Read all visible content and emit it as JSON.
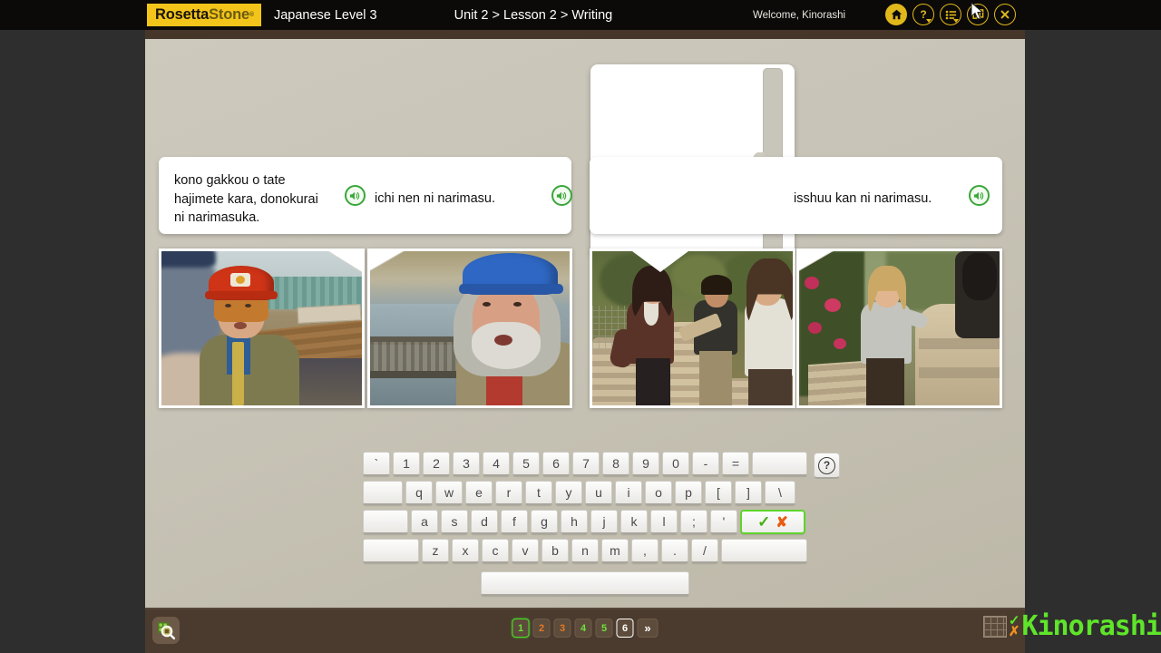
{
  "app": {
    "brand_primary": "RosettaStone",
    "brand_part1": "Rosetta",
    "brand_part2": "Stone",
    "course": "Japanese Level 3",
    "breadcrumb": "Unit 2 > Lesson 2 > Writing",
    "welcome": "Welcome, Kinorashi",
    "accent_yellow": "#f3c51a",
    "accent_green": "#4ddb2a",
    "accent_orange": "#e07a28",
    "bar_dark": "#0c0a08",
    "bar_brown": "#4a3b2e",
    "stage_bg": "#c7c3b6"
  },
  "topbar": {
    "icons": [
      {
        "name": "home-icon",
        "label": "Home",
        "glyph": "home",
        "dropdown": false,
        "filled": true
      },
      {
        "name": "help-icon",
        "label": "Help",
        "glyph": "?",
        "dropdown": true,
        "filled": false
      },
      {
        "name": "menu-icon",
        "label": "Menu",
        "glyph": "list",
        "dropdown": true,
        "filled": false
      },
      {
        "name": "resources-icon",
        "label": "Resources",
        "glyph": "book",
        "dropdown": false,
        "filled": false
      },
      {
        "name": "close-icon",
        "label": "Close",
        "glyph": "x",
        "dropdown": false,
        "filled": false
      }
    ]
  },
  "panels": [
    {
      "id": "panel-question",
      "text": "kono gakkou o tate\nhajimete kara, donokurai\nni narimasuka.",
      "speaker_label": "Play audio",
      "has_speaker": true
    },
    {
      "id": "panel-answer-1",
      "text": "ichi nen ni narimasu.",
      "speaker_label": "Play audio",
      "has_speaker": true
    },
    {
      "id": "panel-answer-2",
      "text": "isshuu kan ni narimasu.",
      "speaker_label": "Play audio",
      "has_speaker": true
    }
  ],
  "writing_input": {
    "value": "",
    "placeholder": "",
    "caret_visible": true
  },
  "photos": [
    {
      "id": "photo-1",
      "alt": "Man in red hard hat at construction site talking"
    },
    {
      "id": "photo-2",
      "alt": "Bearded man in blue hard hat with hood outdoors"
    },
    {
      "id": "photo-3",
      "alt": "Woman in brown top with people stacking stones in garden"
    },
    {
      "id": "photo-4",
      "alt": "Woman in grey sweater beside stone wall in garden"
    }
  ],
  "keyboard": {
    "help_label": "?",
    "rows": [
      {
        "name": "keyboard-row-numbers",
        "keys": [
          {
            "label": "`",
            "cls": ""
          },
          {
            "label": "1",
            "cls": ""
          },
          {
            "label": "2",
            "cls": ""
          },
          {
            "label": "3",
            "cls": ""
          },
          {
            "label": "4",
            "cls": ""
          },
          {
            "label": "5",
            "cls": ""
          },
          {
            "label": "6",
            "cls": ""
          },
          {
            "label": "7",
            "cls": ""
          },
          {
            "label": "8",
            "cls": ""
          },
          {
            "label": "9",
            "cls": ""
          },
          {
            "label": "0",
            "cls": ""
          },
          {
            "label": "-",
            "cls": ""
          },
          {
            "label": "=",
            "cls": ""
          },
          {
            "label": "",
            "cls": "wide-bsp",
            "name": "backspace-key"
          }
        ]
      },
      {
        "name": "keyboard-row-top",
        "keys": [
          {
            "label": "",
            "cls": "wide-tab",
            "name": "tab-key"
          },
          {
            "label": "q",
            "cls": ""
          },
          {
            "label": "w",
            "cls": ""
          },
          {
            "label": "e",
            "cls": ""
          },
          {
            "label": "r",
            "cls": ""
          },
          {
            "label": "t",
            "cls": ""
          },
          {
            "label": "y",
            "cls": ""
          },
          {
            "label": "u",
            "cls": ""
          },
          {
            "label": "i",
            "cls": ""
          },
          {
            "label": "o",
            "cls": ""
          },
          {
            "label": "p",
            "cls": ""
          },
          {
            "label": "[",
            "cls": ""
          },
          {
            "label": "]",
            "cls": ""
          },
          {
            "label": "\\",
            "cls": "wide-bslash"
          }
        ]
      },
      {
        "name": "keyboard-row-home",
        "keys": [
          {
            "label": "",
            "cls": "wide-caps",
            "name": "capslock-key"
          },
          {
            "label": "a",
            "cls": ""
          },
          {
            "label": "s",
            "cls": ""
          },
          {
            "label": "d",
            "cls": ""
          },
          {
            "label": "f",
            "cls": ""
          },
          {
            "label": "g",
            "cls": ""
          },
          {
            "label": "h",
            "cls": ""
          },
          {
            "label": "j",
            "cls": ""
          },
          {
            "label": "k",
            "cls": ""
          },
          {
            "label": "l",
            "cls": ""
          },
          {
            "label": ";",
            "cls": ""
          },
          {
            "label": "'",
            "cls": ""
          },
          {
            "label": "",
            "cls": "enter",
            "name": "enter-key",
            "enter": true
          }
        ]
      },
      {
        "name": "keyboard-row-bottom",
        "keys": [
          {
            "label": "",
            "cls": "wide-shift",
            "name": "shift-left-key"
          },
          {
            "label": "z",
            "cls": ""
          },
          {
            "label": "x",
            "cls": ""
          },
          {
            "label": "c",
            "cls": ""
          },
          {
            "label": "v",
            "cls": ""
          },
          {
            "label": "b",
            "cls": ""
          },
          {
            "label": "n",
            "cls": ""
          },
          {
            "label": "m",
            "cls": ""
          },
          {
            "label": ",",
            "cls": ""
          },
          {
            "label": ".",
            "cls": ""
          },
          {
            "label": "/",
            "cls": ""
          },
          {
            "label": "",
            "cls": "wide-shiftr",
            "name": "shift-right-key"
          }
        ]
      }
    ],
    "space_label": ""
  },
  "bottombar": {
    "search_label": "Zoom",
    "pager": [
      {
        "label": "1",
        "state": "correct",
        "selected": "green"
      },
      {
        "label": "2",
        "state": "wrong",
        "selected": ""
      },
      {
        "label": "3",
        "state": "wrong",
        "selected": ""
      },
      {
        "label": "4",
        "state": "correct",
        "selected": ""
      },
      {
        "label": "5",
        "state": "correct",
        "selected": ""
      },
      {
        "label": "6",
        "state": "current",
        "selected": "white"
      }
    ],
    "next_label": "»"
  },
  "watermark": {
    "name": "Kinorashi",
    "check": "✓",
    "cross": "✗"
  }
}
